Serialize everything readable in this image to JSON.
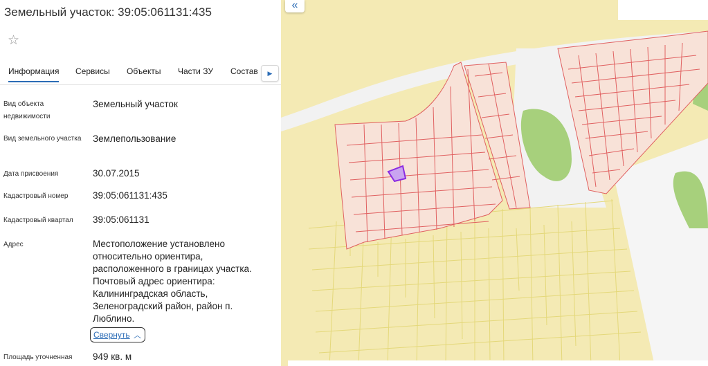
{
  "panel": {
    "title": "Земельный участок: 39:05:061131:435",
    "favorite_icon": "star-icon",
    "tabs": [
      {
        "label": "Информация",
        "active": true
      },
      {
        "label": "Сервисы"
      },
      {
        "label": "Объекты"
      },
      {
        "label": "Части ЗУ"
      },
      {
        "label": "Состав"
      }
    ],
    "tabs_next_icon": "arrow-right-icon",
    "fields": [
      {
        "label": "Вид объекта недвижимости",
        "value": "Земельный участок"
      },
      {
        "label": "Вид земельного участка",
        "value": "Землепользование"
      },
      {
        "label": "Дата присвоения",
        "value": "30.07.2015"
      },
      {
        "label": "Кадастровый номер",
        "value": "39:05:061131:435"
      },
      {
        "label": "Кадастровый квартал",
        "value": "39:05:061131"
      },
      {
        "label": "Адрес",
        "value": "Местоположение установлено относительно ориентира, расположенного в границах участка. Почтовый адрес ориентира: Калининградская область, Зеленоградский район, район п. Люблино."
      },
      {
        "label": "Площадь уточненная",
        "value": "949 кв. м"
      }
    ],
    "collapse_label": "Свернуть",
    "collapse_icon": "chevron-up-icon"
  },
  "map": {
    "collapse_panel_icon": "double-chevron-left-icon",
    "colors": {
      "background": "#f4eab4",
      "cadastral_zone": "#f8e2d8",
      "cadastral_line": "#e06060",
      "yellow_line": "#e4d87a",
      "green": "#a7d07c",
      "road": "#f2f2f2",
      "selected_parcel": "#8a2be2"
    }
  }
}
